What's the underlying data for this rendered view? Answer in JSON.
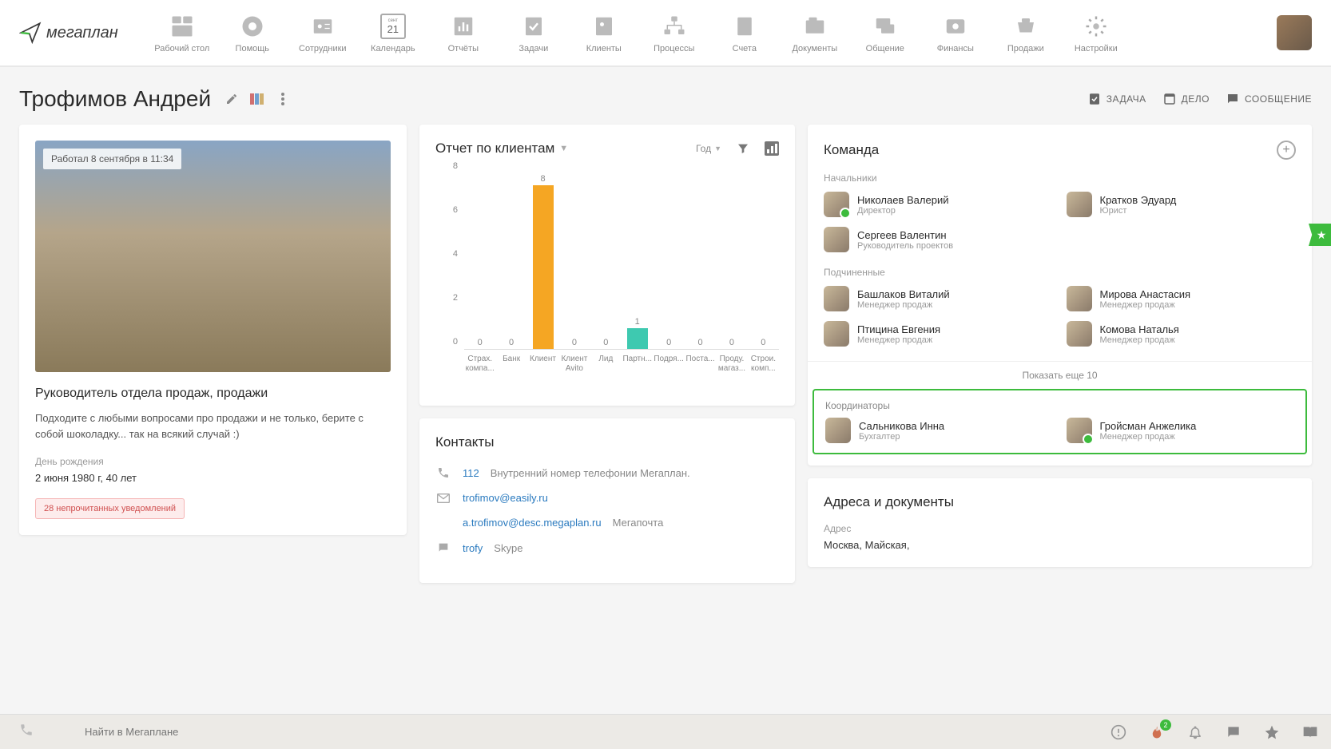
{
  "nav": {
    "logo": "мегаплан",
    "items": [
      {
        "label": "Рабочий стол",
        "icon": "dashboard"
      },
      {
        "label": "Помощь",
        "icon": "help"
      },
      {
        "label": "Сотрудники",
        "icon": "employees"
      },
      {
        "label": "Календарь",
        "icon": "calendar",
        "day": "21",
        "month": "сент"
      },
      {
        "label": "Отчёты",
        "icon": "reports"
      },
      {
        "label": "Задачи",
        "icon": "tasks"
      },
      {
        "label": "Клиенты",
        "icon": "clients"
      },
      {
        "label": "Процессы",
        "icon": "processes"
      },
      {
        "label": "Счета",
        "icon": "invoices"
      },
      {
        "label": "Документы",
        "icon": "documents"
      },
      {
        "label": "Общение",
        "icon": "chat"
      },
      {
        "label": "Финансы",
        "icon": "finance"
      },
      {
        "label": "Продажи",
        "icon": "sales"
      },
      {
        "label": "Настройки",
        "icon": "settings"
      }
    ]
  },
  "header": {
    "title": "Трофимов Андрей",
    "actions": [
      {
        "label": "ЗАДАЧА",
        "icon": "task"
      },
      {
        "label": "ДЕЛО",
        "icon": "todo"
      },
      {
        "label": "СООБЩЕНИЕ",
        "icon": "message"
      }
    ]
  },
  "profile": {
    "last_worked": "Работал 8 сентября в 11:34",
    "role": "Руководитель отдела продаж, продажи",
    "bio": "Подходите с любыми вопросами про продажи и не только, берите с собой шоколадку... так на всякий случай :)",
    "birthday_label": "День рождения",
    "birthday_value": "2 июня 1980 г, 40 лет",
    "notifications": "28 непрочитанных уведомлений"
  },
  "report": {
    "title": "Отчет по клиентам",
    "period": "Год"
  },
  "chart_data": {
    "type": "bar",
    "title": "Отчет по клиентам",
    "categories": [
      "Страх. компа...",
      "Банк",
      "Клиент",
      "Клиент Avito",
      "Лид",
      "Партн...",
      "Подря...",
      "Поста...",
      "Проду. магаз...",
      "Строи. комп..."
    ],
    "values": [
      0,
      0,
      8,
      0,
      0,
      1,
      0,
      0,
      0,
      0
    ],
    "ylabel": "",
    "xlabel": "",
    "ylim": [
      0,
      8
    ],
    "yticks": [
      0,
      2,
      4,
      6,
      8
    ],
    "colors": {
      "Клиент": "#f5a623",
      "Партн...": "#3ec9b0"
    }
  },
  "contacts": {
    "title": "Контакты",
    "phone": "112",
    "phone_note": "Внутренний номер телефонии Мегаплан.",
    "email1": "trofimov@easily.ru",
    "email2": "a.trofimov@desc.megaplan.ru",
    "email2_note": "Мегапочта",
    "skype": "trofy",
    "skype_note": "Skype"
  },
  "team": {
    "title": "Команда",
    "bosses_label": "Начальники",
    "bosses": [
      {
        "name": "Николаев Валерий",
        "role": "Директор",
        "online": true
      },
      {
        "name": "Кратков Эдуард",
        "role": "Юрист",
        "online": false
      },
      {
        "name": "Сергеев Валентин",
        "role": "Руководитель проектов",
        "online": false
      }
    ],
    "subs_label": "Подчиненные",
    "subs": [
      {
        "name": "Башлаков Виталий",
        "role": "Менеджер продаж",
        "online": false
      },
      {
        "name": "Мирова Анастасия",
        "role": "Менеджер продаж",
        "online": false
      },
      {
        "name": "Птицина Евгения",
        "role": "Менеджер продаж",
        "online": false
      },
      {
        "name": "Комова Наталья",
        "role": "Менеджер продаж",
        "online": false
      }
    ],
    "show_more": "Показать еще 10",
    "coord_label": "Координаторы",
    "coords": [
      {
        "name": "Сальникова Инна",
        "role": "Бухгалтер",
        "online": false
      },
      {
        "name": "Гройсман Анжелика",
        "role": "Менеджер продаж",
        "online": true
      }
    ]
  },
  "address": {
    "title": "Адреса и документы",
    "label": "Адрес",
    "value": "Москва, Майская,"
  },
  "bottombar": {
    "search_placeholder": "Найти в Мегаплане",
    "fire_badge": "2"
  }
}
